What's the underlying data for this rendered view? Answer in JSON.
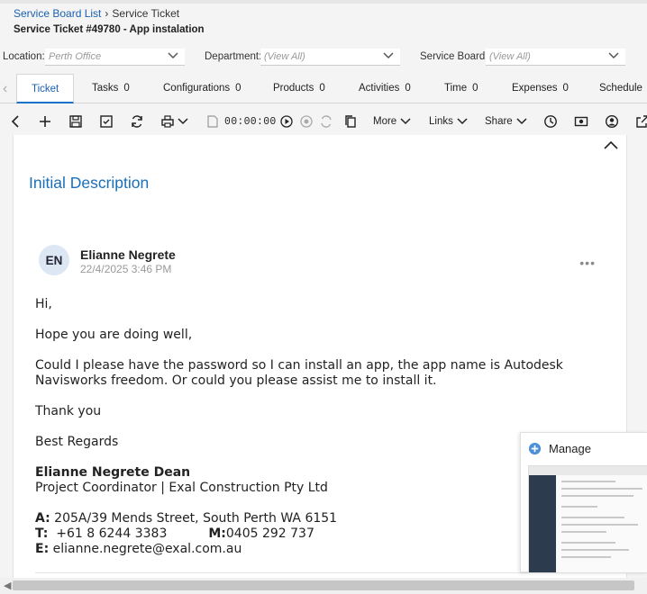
{
  "breadcrumb": {
    "parent": "Service Board List",
    "current": "Service Ticket"
  },
  "page_title": "Service Ticket #49780 - App instalation",
  "filters": {
    "location_label": "Location:",
    "location_value": "Perth Office",
    "department_label": "Department:",
    "department_value": "(View All)",
    "board_label": "Service Board:",
    "board_value": "(View All)"
  },
  "tabs": [
    {
      "label": "Ticket",
      "count": ""
    },
    {
      "label": "Tasks",
      "count": "0"
    },
    {
      "label": "Configurations",
      "count": "0"
    },
    {
      "label": "Products",
      "count": "0"
    },
    {
      "label": "Activities",
      "count": "0"
    },
    {
      "label": "Time",
      "count": "0"
    },
    {
      "label": "Expenses",
      "count": "0"
    },
    {
      "label": "Schedule",
      "count": ""
    }
  ],
  "toolbar": {
    "timer": "00:00:00",
    "more": "More",
    "links": "Links",
    "share": "Share"
  },
  "section": {
    "title": "Initial Description"
  },
  "note": {
    "initials": "EN",
    "author": "Elianne Negrete",
    "date": "22/4/2025 3:46 PM",
    "greeting": "Hi,",
    "line1": "Hope you are doing well,",
    "line2": "Could I please have the password so I can install an app, the app name is Autodesk Navisworks freedom. Or could you please assist me to install it.",
    "line3": "Thank you",
    "line4": "Best Regards",
    "sig_name": "Elianne Negrete Dean",
    "sig_title": "Project Coordinator | Exal Construction Pty Ltd",
    "addr_label": "A:",
    "addr": "205A/39 Mends Street, South Perth WA 6151",
    "tel_label": "T:",
    "tel": "+61 8 6244 3383",
    "mob_label": "M:",
    "mob": "0405 292 737",
    "email_label": "E:",
    "email": "elianne.negrete@exal.com.au"
  },
  "manage": {
    "label": "Manage"
  },
  "colors": {
    "accent": "#1a6fb8",
    "active_tab_border": "#1a73c8"
  }
}
